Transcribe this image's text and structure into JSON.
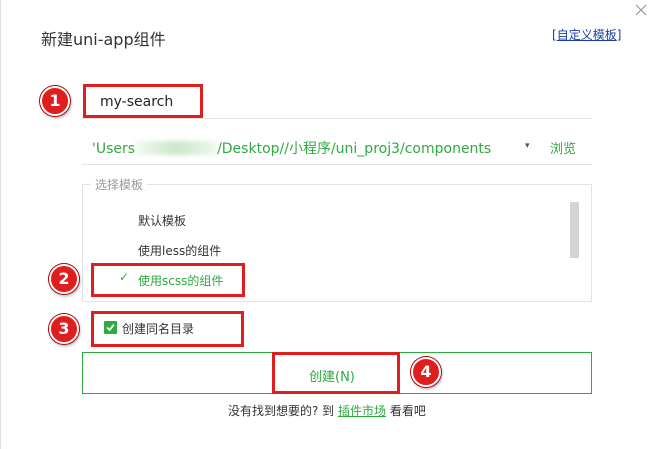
{
  "dialog": {
    "title": "新建uni-app组件",
    "custom_template_link": "自定义模板",
    "bracket_open": "[",
    "bracket_close": "]",
    "close_icon": "close-icon"
  },
  "name_input": {
    "value": "my-search"
  },
  "path": {
    "prefix": "'Users",
    "suffix": "/Desktop//小程序/uni_proj3/components",
    "dropdown_icon": "▾",
    "browse_label": "浏览"
  },
  "template_select": {
    "legend": "选择模板",
    "items": [
      {
        "label": "默认模板",
        "selected": false
      },
      {
        "label": "使用less的组件",
        "selected": false
      },
      {
        "label": "使用scss的组件",
        "selected": true
      }
    ],
    "check_glyph": "✓"
  },
  "create_dir_checkbox": {
    "label": "创建同名目录",
    "checked": true
  },
  "create_button": {
    "label": "创建(N)"
  },
  "footer": {
    "text_before": "没有找到想要的? 到",
    "market_link": "插件市场",
    "text_after": "看看吧"
  },
  "annotations": {
    "badges": [
      "1",
      "2",
      "3",
      "4"
    ],
    "color": "#e01e1e"
  },
  "colors": {
    "accent": "#2eaa3e",
    "link": "#1a3fa8"
  }
}
